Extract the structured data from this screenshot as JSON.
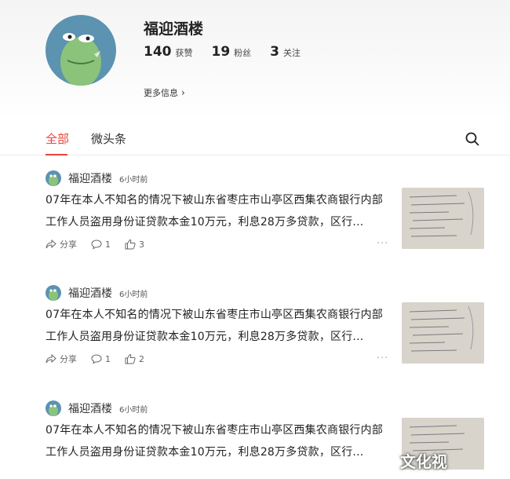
{
  "profile": {
    "name": "福迎酒楼",
    "stats": [
      {
        "num": "140",
        "label": "获赞"
      },
      {
        "num": "19",
        "label": "粉丝"
      },
      {
        "num": "3",
        "label": "关注"
      }
    ],
    "more_info": "更多信息"
  },
  "tabs": [
    {
      "label": "全部",
      "active": true
    },
    {
      "label": "微头条",
      "active": false
    }
  ],
  "posts": [
    {
      "author": "福迎酒楼",
      "time": "6小时前",
      "text": "07年在本人不知名的情况下被山东省枣庄市山亭区西集农商银行内部工作人员盗用身份证贷款本金10万元，利息28万多贷款，区行...",
      "share": "分享",
      "comments": "1",
      "likes": "3"
    },
    {
      "author": "福迎酒楼",
      "time": "6小时前",
      "text": "07年在本人不知名的情况下被山东省枣庄市山亭区西集农商银行内部工作人员盗用身份证贷款本金10万元，利息28万多贷款，区行...",
      "share": "分享",
      "comments": "1",
      "likes": "2"
    },
    {
      "author": "福迎酒楼",
      "time": "6小时前",
      "text": "07年在本人不知名的情况下被山东省枣庄市山亭区西集农商银行内部工作人员盗用身份证贷款本金10万元，利息28万多贷款，区行..."
    }
  ],
  "watermark": "文化视",
  "colors": {
    "accent": "#e8453c",
    "avatar_bg": "#5b93b0",
    "avatar_face": "#8bc37a"
  }
}
